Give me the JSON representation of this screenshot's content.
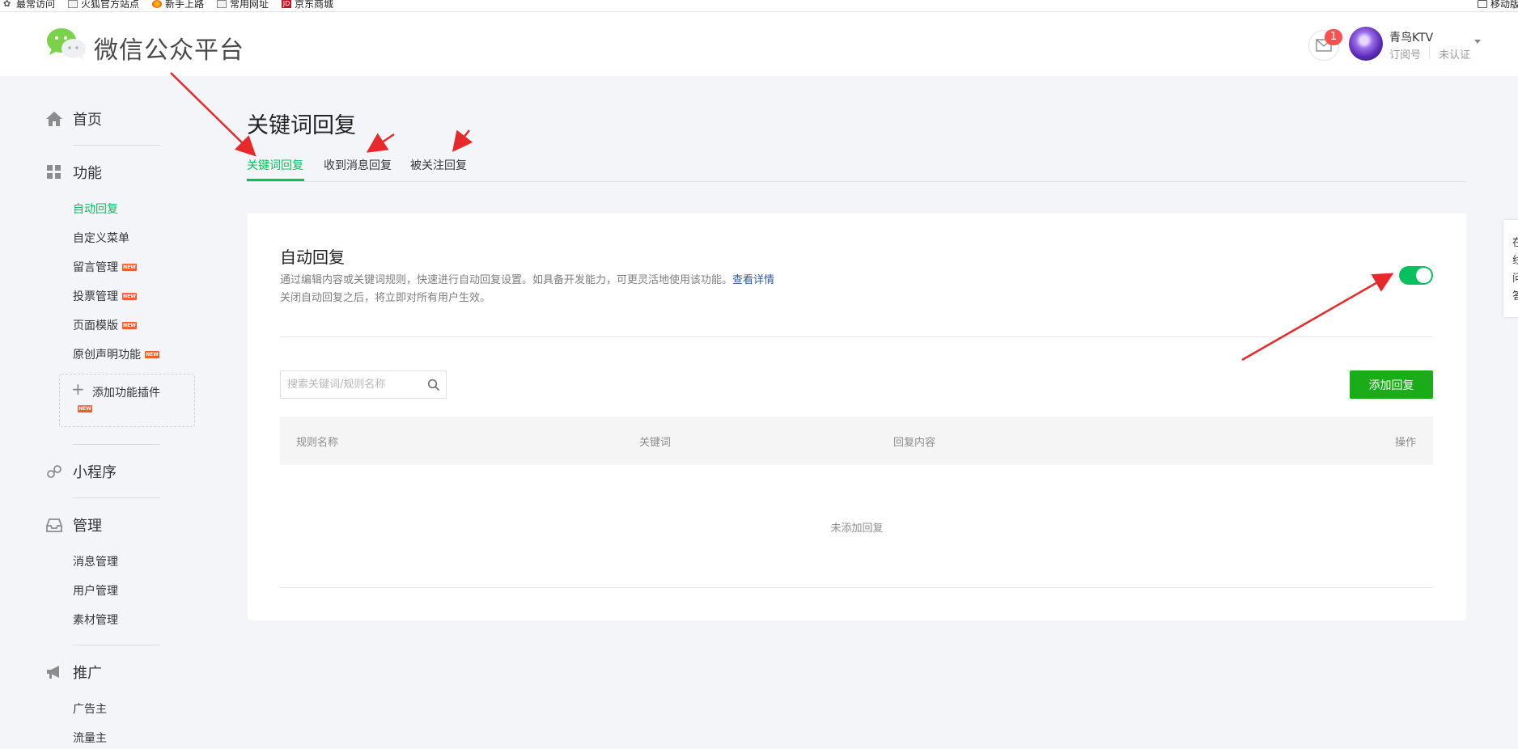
{
  "bookmarks": [
    {
      "label": "最常访问",
      "icon": "star-icon"
    },
    {
      "label": "火狐官方站点",
      "icon": "page-icon"
    },
    {
      "label": "新手上路",
      "icon": "firefox-icon"
    },
    {
      "label": "常用网址",
      "icon": "page-icon"
    },
    {
      "label": "京东商城",
      "icon": "jd-icon"
    },
    {
      "label": "移动版",
      "icon": "phone-icon"
    }
  ],
  "header": {
    "brand": "微信公众平台",
    "notification_count": "1",
    "account_name": "青鸟KTV",
    "account_type": "订阅号",
    "account_verify": "未认证"
  },
  "sidebar": {
    "home": "首页",
    "features": "功能",
    "feature_items": [
      {
        "label": "自动回复",
        "active": true,
        "new": false
      },
      {
        "label": "自定义菜单",
        "active": false,
        "new": false
      },
      {
        "label": "留言管理",
        "active": false,
        "new": true
      },
      {
        "label": "投票管理",
        "active": false,
        "new": true
      },
      {
        "label": "页面模版",
        "active": false,
        "new": true
      },
      {
        "label": "原创声明功能",
        "active": false,
        "new": true
      }
    ],
    "add_plugin": "添加功能插件",
    "new_tag": "NEW",
    "miniprogram": "小程序",
    "management": "管理",
    "management_items": [
      "消息管理",
      "用户管理",
      "素材管理"
    ],
    "promotion": "推广",
    "promotion_items": [
      "广告主",
      "流量主"
    ]
  },
  "main": {
    "title": "关键词回复",
    "tabs": [
      "关键词回复",
      "收到消息回复",
      "被关注回复"
    ],
    "active_tab": 0,
    "card": {
      "title": "自动回复",
      "desc": "通过编辑内容或关键词规则，快速进行自动回复设置。如具备开发能力，可更灵活地使用该功能。",
      "desc_link": "查看详情",
      "desc2": "关闭自动回复之后，将立即对所有用户生效。",
      "toggle_on": true
    },
    "search_placeholder": "搜索关键词/规则名称",
    "add_button": "添加回复",
    "table_headers": [
      "规则名称",
      "关键词",
      "回复内容",
      "操作"
    ],
    "empty_text": "未添加回复"
  },
  "side_panel": [
    "在",
    "线",
    "问",
    "答"
  ],
  "colors": {
    "accent": "#07c160",
    "button": "#1aad19",
    "badge": "#fa5151",
    "new_tag": "#f25d2c",
    "annotation": "#e8292b"
  }
}
